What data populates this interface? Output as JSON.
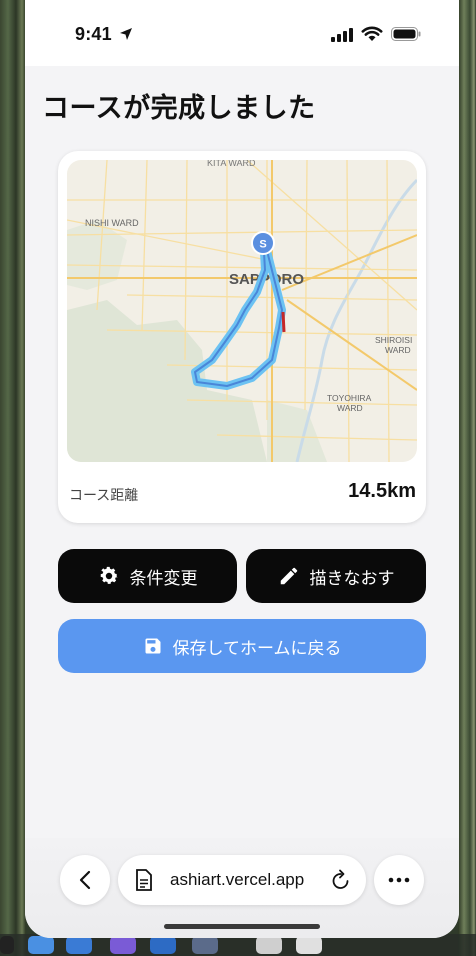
{
  "status_bar": {
    "time": "9:41"
  },
  "page": {
    "title": "コースが完成しました"
  },
  "course_card": {
    "map": {
      "labels": {
        "top": "KITA WARD",
        "nishi": "NISHI WARD",
        "sapporo": "SAPPORO",
        "shiroishi_1": "SHIROISI",
        "shiroishi_2": "WARD",
        "toyohira_1": "TOYOHIRA",
        "toyohira_2": "WARD"
      },
      "start_marker": "S",
      "route_color": "#5ab0ec"
    },
    "distance_label": "コース距離",
    "distance_value": "14.5km"
  },
  "actions": {
    "change_conditions": "条件変更",
    "redraw": "描きなおす",
    "save_and_home": "保存してホームに戻る"
  },
  "browser": {
    "url": "ashiart.vercel.app"
  },
  "colors": {
    "primary_blue": "#5a97f0",
    "dark_button": "#0a0a0a"
  }
}
